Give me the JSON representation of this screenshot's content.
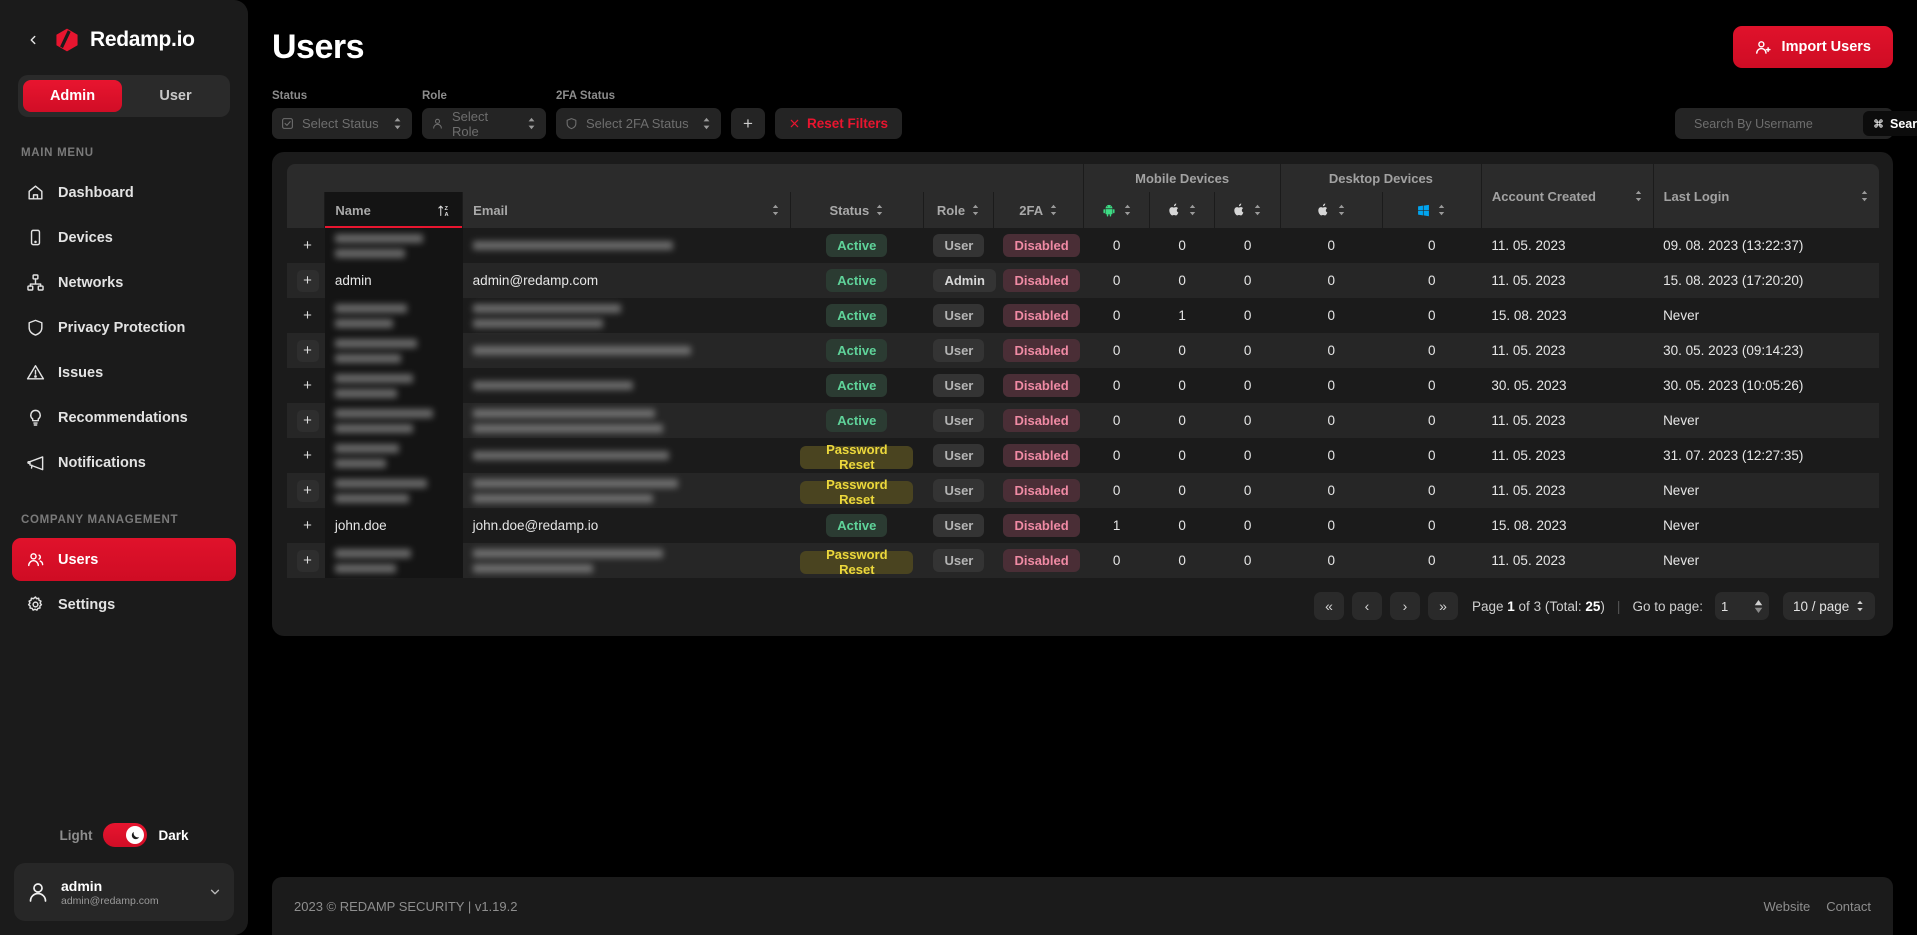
{
  "sidebar": {
    "brand": "Redamp.io",
    "collapse_icon": "chevron-left-icon",
    "role_toggle": {
      "admin": "Admin",
      "user": "User",
      "active": "Admin"
    },
    "sections": [
      {
        "title": "MAIN MENU",
        "items": [
          {
            "label": "Dashboard",
            "icon": "home-icon",
            "active": false
          },
          {
            "label": "Devices",
            "icon": "device-icon",
            "active": false
          },
          {
            "label": "Networks",
            "icon": "network-icon",
            "active": false
          },
          {
            "label": "Privacy Protection",
            "icon": "shield-icon",
            "active": false
          },
          {
            "label": "Issues",
            "icon": "warning-icon",
            "active": false
          },
          {
            "label": "Recommendations",
            "icon": "lightbulb-icon",
            "active": false
          },
          {
            "label": "Notifications",
            "icon": "megaphone-icon",
            "active": false
          }
        ]
      },
      {
        "title": "COMPANY MANAGEMENT",
        "items": [
          {
            "label": "Users",
            "icon": "users-icon",
            "active": true
          },
          {
            "label": "Settings",
            "icon": "gear-icon",
            "active": false
          }
        ]
      }
    ],
    "theme": {
      "light_label": "Light",
      "dark_label": "Dark",
      "active": "Dark",
      "knob_icon": "moon-icon"
    },
    "profile": {
      "name": "admin",
      "email": "admin@redamp.com",
      "avatar_icon": "user-icon",
      "chevron": "chevron-down-icon"
    }
  },
  "header": {
    "title": "Users",
    "import_button": {
      "label": "Import Users",
      "icon": "user-plus-icon"
    }
  },
  "filters": {
    "status": {
      "label": "Status",
      "placeholder": "Select Status",
      "icon": "checkbox-icon"
    },
    "role": {
      "label": "Role",
      "placeholder": "Select Role",
      "icon": "user-icon"
    },
    "twofa": {
      "label": "2FA Status",
      "placeholder": "Select 2FA Status",
      "icon": "shield-icon"
    },
    "add_button": "+",
    "reset_button": {
      "label": "Reset Filters",
      "icon": "close-icon"
    }
  },
  "search": {
    "placeholder": "Search By Username",
    "value": "",
    "button_label": "Search",
    "button_icon": "command-icon",
    "icon": "search-icon"
  },
  "table": {
    "group_headers": {
      "mobile": "Mobile Devices",
      "desktop": "Desktop Devices"
    },
    "columns": [
      {
        "key": "expand",
        "label": ""
      },
      {
        "key": "name",
        "label": "Name",
        "sort": "za"
      },
      {
        "key": "email",
        "label": "Email",
        "sort": "none"
      },
      {
        "key": "status",
        "label": "Status",
        "sort": "none"
      },
      {
        "key": "role",
        "label": "Role",
        "sort": "none"
      },
      {
        "key": "twofa",
        "label": "2FA",
        "sort": "none"
      },
      {
        "key": "m_android",
        "label": "",
        "icon": "android-icon",
        "sort": "none"
      },
      {
        "key": "m_apple1",
        "label": "",
        "icon": "apple-icon",
        "sort": "none"
      },
      {
        "key": "m_apple2",
        "label": "",
        "icon": "apple-icon",
        "sort": "none"
      },
      {
        "key": "d_apple",
        "label": "",
        "icon": "apple-icon",
        "sort": "none"
      },
      {
        "key": "d_windows",
        "label": "",
        "icon": "windows-icon",
        "sort": "none"
      },
      {
        "key": "created",
        "label": "Account Created",
        "sort": "none"
      },
      {
        "key": "lastlogin",
        "label": "Last Login",
        "sort": "none"
      }
    ],
    "rows": [
      {
        "name": "",
        "name_redacted": true,
        "name_w": 88,
        "email": "",
        "email_redacted": true,
        "email_w": [
          200,
          0
        ],
        "status": "Active",
        "status_type": "active",
        "role": "User",
        "twofa": "Disabled",
        "devices": [
          0,
          0,
          0,
          0,
          0
        ],
        "created": "11. 05. 2023",
        "lastlogin": "09. 08. 2023 (13:22:37)"
      },
      {
        "name": "admin",
        "name_redacted": false,
        "email": "admin@redamp.com",
        "email_redacted": false,
        "status": "Active",
        "status_type": "active",
        "role": "Admin",
        "twofa": "Disabled",
        "devices": [
          0,
          0,
          0,
          0,
          0
        ],
        "created": "11. 05. 2023",
        "lastlogin": "15. 08. 2023 (17:20:20)"
      },
      {
        "name": "",
        "name_redacted": true,
        "name_w": 72,
        "email": "",
        "email_redacted": true,
        "email_w": [
          148,
          130
        ],
        "status": "Active",
        "status_type": "active",
        "role": "User",
        "twofa": "Disabled",
        "devices": [
          0,
          1,
          0,
          0,
          0
        ],
        "created": "15. 08. 2023",
        "lastlogin": "Never"
      },
      {
        "name": "",
        "name_redacted": true,
        "name_w": 82,
        "email": "",
        "email_redacted": true,
        "email_w": [
          218,
          0
        ],
        "status": "Active",
        "status_type": "active",
        "role": "User",
        "twofa": "Disabled",
        "devices": [
          0,
          0,
          0,
          0,
          0
        ],
        "created": "11. 05. 2023",
        "lastlogin": "30. 05. 2023 (09:14:23)"
      },
      {
        "name": "",
        "name_redacted": true,
        "name_w": 78,
        "email": "",
        "email_redacted": true,
        "email_w": [
          160,
          0
        ],
        "status": "Active",
        "status_type": "active",
        "role": "User",
        "twofa": "Disabled",
        "devices": [
          0,
          0,
          0,
          0,
          0
        ],
        "created": "30. 05. 2023",
        "lastlogin": "30. 05. 2023 (10:05:26)"
      },
      {
        "name": "",
        "name_redacted": true,
        "name_w": 98,
        "email": "",
        "email_redacted": true,
        "email_w": [
          182,
          190
        ],
        "status": "Active",
        "status_type": "active",
        "role": "User",
        "twofa": "Disabled",
        "devices": [
          0,
          0,
          0,
          0,
          0
        ],
        "created": "11. 05. 2023",
        "lastlogin": "Never"
      },
      {
        "name": "",
        "name_redacted": true,
        "name_w": 64,
        "email": "",
        "email_redacted": true,
        "email_w": [
          196,
          0
        ],
        "status": "Password Reset",
        "status_type": "pwreset",
        "role": "User",
        "twofa": "Disabled",
        "devices": [
          0,
          0,
          0,
          0,
          0
        ],
        "created": "11. 05. 2023",
        "lastlogin": "31. 07. 2023 (12:27:35)"
      },
      {
        "name": "",
        "name_redacted": true,
        "name_w": 92,
        "email": "",
        "email_redacted": true,
        "email_w": [
          205,
          180
        ],
        "status": "Password Reset",
        "status_type": "pwreset",
        "role": "User",
        "twofa": "Disabled",
        "devices": [
          0,
          0,
          0,
          0,
          0
        ],
        "created": "11. 05. 2023",
        "lastlogin": "Never"
      },
      {
        "name": "john.doe",
        "name_redacted": false,
        "email": "john.doe@redamp.io",
        "email_redacted": false,
        "status": "Active",
        "status_type": "active",
        "role": "User",
        "twofa": "Disabled",
        "devices": [
          1,
          0,
          0,
          0,
          0
        ],
        "created": "15. 08. 2023",
        "lastlogin": "Never"
      },
      {
        "name": "",
        "name_redacted": true,
        "name_w": 76,
        "email": "",
        "email_redacted": true,
        "email_w": [
          190,
          120
        ],
        "status": "Password Reset",
        "status_type": "pwreset",
        "role": "User",
        "twofa": "Disabled",
        "devices": [
          0,
          0,
          0,
          0,
          0
        ],
        "created": "11. 05. 2023",
        "lastlogin": "Never"
      }
    ]
  },
  "pagination": {
    "first": "«",
    "prev": "‹",
    "next": "›",
    "last": "»",
    "page_prefix": "Page",
    "page_num": "1",
    "of": "of",
    "total_pages": "3",
    "total_label": "(Total:",
    "total_count": "25",
    "total_close": ")",
    "goto_label": "Go to page:",
    "goto_value": "1",
    "per_page": "10 / page"
  },
  "footer": {
    "copyright": "2023 © REDAMP SECURITY | v1.19.2",
    "links": [
      "Website",
      "Contact"
    ]
  },
  "colors": {
    "accent": "#e8152f",
    "sidebar_bg": "#1b1b1b",
    "page_bg": "#0d0d0d",
    "active_badge": "#5fd39a",
    "pwreset_badge": "#ecd83c",
    "disabled_badge": "#f08aa4",
    "android": "#3ddc84",
    "windows": "#00a4ef"
  }
}
